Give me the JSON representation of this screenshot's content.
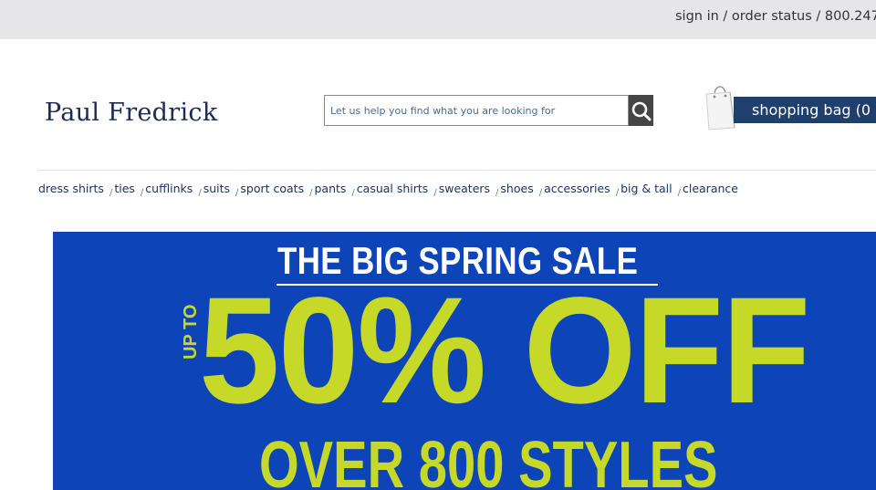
{
  "utility": {
    "sign_in": "sign in",
    "sep1": " / ",
    "order_status": "order status",
    "sep2": " / ",
    "phone": "800.247."
  },
  "brand": {
    "logo_text": "Paul Fredrick"
  },
  "search": {
    "placeholder": "Let us help you find what you are looking for",
    "icon": "search-icon"
  },
  "cart": {
    "label": "shopping bag (0",
    "icon": "shopping-bag-icon"
  },
  "nav": {
    "separator": "/",
    "items": [
      {
        "label": "dress shirts"
      },
      {
        "label": "ties"
      },
      {
        "label": "cufflinks"
      },
      {
        "label": "suits"
      },
      {
        "label": "sport coats"
      },
      {
        "label": "pants"
      },
      {
        "label": "casual shirts"
      },
      {
        "label": "sweaters"
      },
      {
        "label": "shoes"
      },
      {
        "label": "accessories"
      },
      {
        "label": "big & tall"
      },
      {
        "label": "clearance"
      }
    ]
  },
  "banner": {
    "headline": "THE BIG SPRING SALE",
    "up_to": "UP TO",
    "offer": "50% OFF",
    "subline": "OVER 800 STYLES"
  },
  "colors": {
    "banner_bg": "#0d44b8",
    "banner_accent": "#c6d929",
    "cart_bg": "#1f3f6e",
    "link": "#1d3566",
    "utility_bg": "#e6e6e8"
  }
}
